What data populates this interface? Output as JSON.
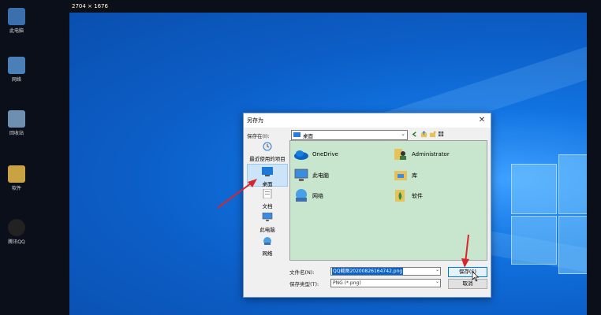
{
  "screenshot": {
    "dimensions": "2704 × 1676"
  },
  "desktop": {
    "icons": [
      {
        "label": "此电脑"
      },
      {
        "label": "网络"
      },
      {
        "label": "回收站"
      },
      {
        "label": "软件"
      },
      {
        "label": "腾讯QQ"
      }
    ]
  },
  "dialog": {
    "title": "另存为",
    "close_glyph": "✕",
    "save_in_label": "保存在(I):",
    "save_in_value": "桌面",
    "places": [
      {
        "label": "最近使用的项目",
        "icon": "recent-icon"
      },
      {
        "label": "桌面",
        "icon": "desktop-icon",
        "selected": true
      },
      {
        "label": "文档",
        "icon": "documents-icon"
      },
      {
        "label": "此电脑",
        "icon": "computer-icon"
      },
      {
        "label": "网络",
        "icon": "network-icon"
      }
    ],
    "items": [
      {
        "label": "OneDrive",
        "icon": "onedrive-icon"
      },
      {
        "label": "Administrator",
        "icon": "user-folder-icon"
      },
      {
        "label": "此电脑",
        "icon": "computer-icon"
      },
      {
        "label": "库",
        "icon": "library-icon"
      },
      {
        "label": "网络",
        "icon": "network-icon"
      },
      {
        "label": "软件",
        "icon": "software-folder-icon"
      }
    ],
    "filename_label": "文件名(N):",
    "filename_value": "QQ截图20200826164742.png",
    "filetype_label": "保存类型(T):",
    "filetype_value": "PNG (*.png)",
    "save_button": "保存(S)",
    "cancel_button": "取消",
    "colors": {
      "list_bg": "#c7e6cd",
      "accent": "#0078d7",
      "annotation": "#d9262b"
    }
  }
}
